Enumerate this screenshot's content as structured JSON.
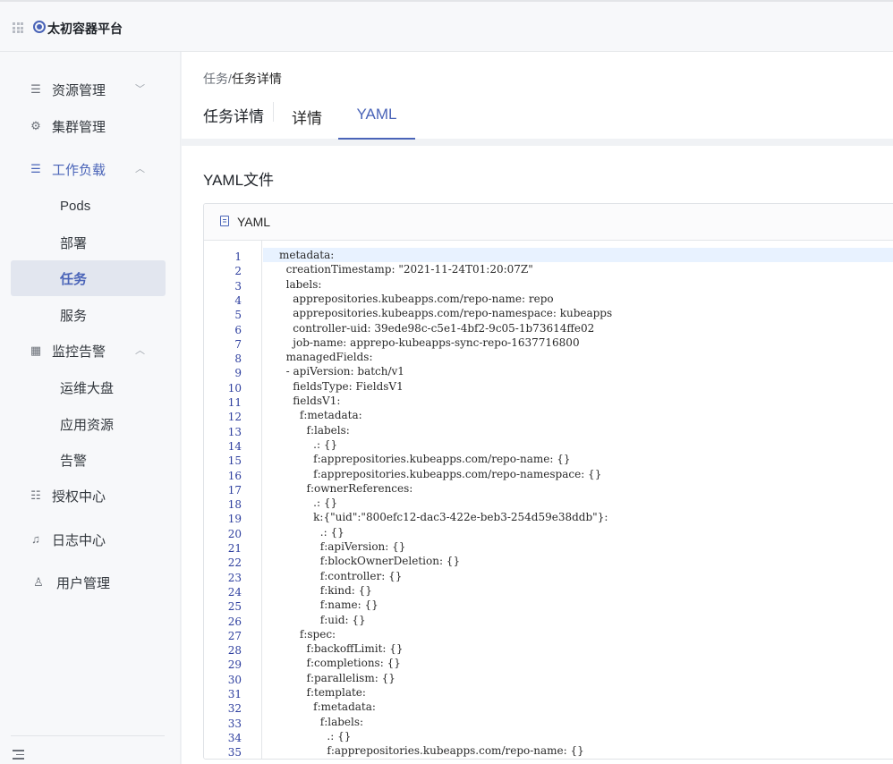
{
  "topbar": {
    "brand": "太初容器平台"
  },
  "sidebar": {
    "items": [
      {
        "label": "资源管理",
        "icon": "sliders-icon",
        "chevron": "down"
      },
      {
        "label": "集群管理",
        "icon": "cluster-icon"
      },
      {
        "label": "工作负载",
        "icon": "sliders-icon",
        "chevron": "up",
        "active": true
      },
      {
        "label": "Pods"
      },
      {
        "label": "部署"
      },
      {
        "label": "任务",
        "selected": true
      },
      {
        "label": "服务"
      },
      {
        "label": "监控告警",
        "icon": "grid-icon",
        "chevron": "up"
      },
      {
        "label": "运维大盘"
      },
      {
        "label": "应用资源"
      },
      {
        "label": "告警"
      },
      {
        "label": "授权中心",
        "icon": "list-icon"
      },
      {
        "label": "日志中心",
        "icon": "bell-icon"
      },
      {
        "label": "用户管理",
        "icon": "user-icon"
      }
    ]
  },
  "breadcrumb": {
    "parent": "任务",
    "separator": "/",
    "current": "任务详情"
  },
  "header": {
    "title": "任务详情",
    "tabs": [
      "详情",
      "YAML"
    ],
    "active_tab": "YAML"
  },
  "content": {
    "section_title": "YAML文件",
    "card_title": "YAML"
  },
  "yaml_lines": [
    "metadata:",
    "  creationTimestamp: \"2021-11-24T01:20:07Z\"",
    "  labels:",
    "    apprepositories.kubeapps.com/repo-name: repo",
    "    apprepositories.kubeapps.com/repo-namespace: kubeapps",
    "    controller-uid: 39ede98c-c5e1-4bf2-9c05-1b73614ffe02",
    "    job-name: apprepo-kubeapps-sync-repo-1637716800",
    "  managedFields:",
    "  - apiVersion: batch/v1",
    "    fieldsType: FieldsV1",
    "    fieldsV1:",
    "      f:metadata:",
    "        f:labels:",
    "          .: {}",
    "          f:apprepositories.kubeapps.com/repo-name: {}",
    "          f:apprepositories.kubeapps.com/repo-namespace: {}",
    "        f:ownerReferences:",
    "          .: {}",
    "          k:{\"uid\":\"800efc12-dac3-422e-beb3-254d59e38ddb\"}:",
    "            .: {}",
    "            f:apiVersion: {}",
    "            f:blockOwnerDeletion: {}",
    "            f:controller: {}",
    "            f:kind: {}",
    "            f:name: {}",
    "            f:uid: {}",
    "      f:spec:",
    "        f:backoffLimit: {}",
    "        f:completions: {}",
    "        f:parallelism: {}",
    "        f:template:",
    "          f:metadata:",
    "            f:labels:",
    "              .: {}",
    "              f:apprepositories.kubeapps.com/repo-name: {}"
  ],
  "colors": {
    "accent": "#4a64b8",
    "line_number": "#2d3e9e",
    "active_line": "#e8f2ff"
  }
}
